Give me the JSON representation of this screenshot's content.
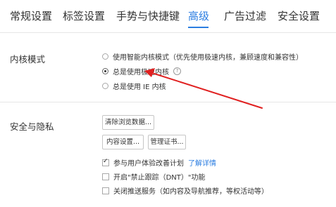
{
  "tabs": [
    {
      "label": "常规设置",
      "active": false
    },
    {
      "label": "标签设置",
      "active": false
    },
    {
      "label": "手势与快捷键",
      "active": false
    },
    {
      "label": "高级",
      "active": true
    },
    {
      "label": "广告过滤",
      "active": false
    },
    {
      "label": "安全设置",
      "active": false
    }
  ],
  "kernel_section": {
    "title": "内核模式",
    "options": [
      {
        "label": "使用智能内核模式（优先使用极速内核，兼顾速度和兼容性）",
        "selected": false
      },
      {
        "label": "总是使用极速内核",
        "selected": true,
        "help_icon": "?"
      },
      {
        "label": "总是使用 IE 内核",
        "selected": false
      }
    ]
  },
  "privacy_section": {
    "title": "安全与隐私",
    "buttons": {
      "clear_data": "清除浏览数据...",
      "content_settings": "内容设置...",
      "manage_certs": "管理证书..."
    },
    "checkboxes": [
      {
        "label": "参与用户体验改善计划",
        "checked": true,
        "link": "了解详情"
      },
      {
        "label": "开启\"禁止跟踪（DNT）\"功能",
        "checked": false
      },
      {
        "label": "关闭推送服务（如内容及导航推荐，等权活动等）",
        "checked": false
      }
    ]
  },
  "colors": {
    "accent": "#2b7de1",
    "annotation_arrow": "#e02020"
  }
}
